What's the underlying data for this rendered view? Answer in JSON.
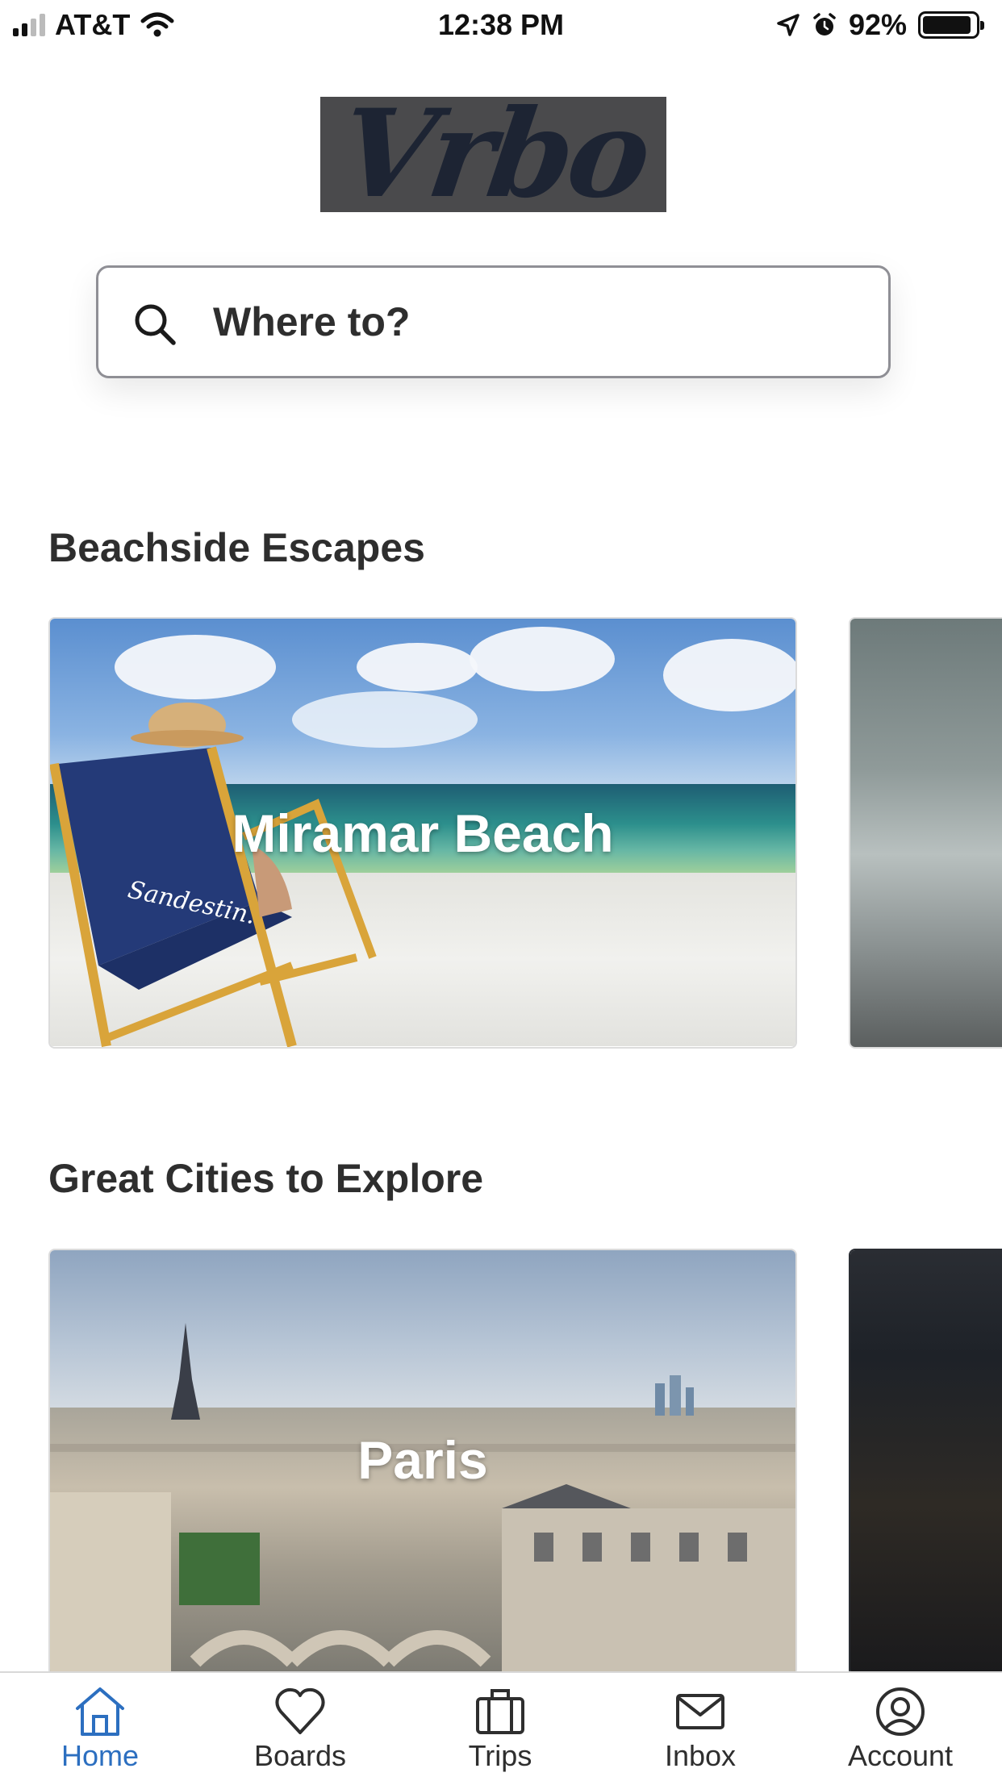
{
  "status_bar": {
    "carrier": "AT&T",
    "time": "12:38 PM",
    "battery_percent": "92%",
    "battery_level": 0.92
  },
  "brand": {
    "logo_text": "Vrbo"
  },
  "search": {
    "placeholder": "Where to?",
    "icon": "search-icon"
  },
  "sections": [
    {
      "title": "Beachside Escapes",
      "cards": [
        {
          "label": "Miramar Beach",
          "chair_text": "Sandestin."
        }
      ]
    },
    {
      "title": "Great Cities to Explore",
      "cards": [
        {
          "label": "Paris"
        }
      ]
    }
  ],
  "tab_bar": {
    "active": "Home",
    "active_color": "#2c6fc0",
    "tabs": [
      {
        "label": "Home",
        "icon": "home-icon"
      },
      {
        "label": "Boards",
        "icon": "heart-icon"
      },
      {
        "label": "Trips",
        "icon": "briefcase-icon"
      },
      {
        "label": "Inbox",
        "icon": "envelope-icon"
      },
      {
        "label": "Account",
        "icon": "account-icon"
      }
    ]
  }
}
